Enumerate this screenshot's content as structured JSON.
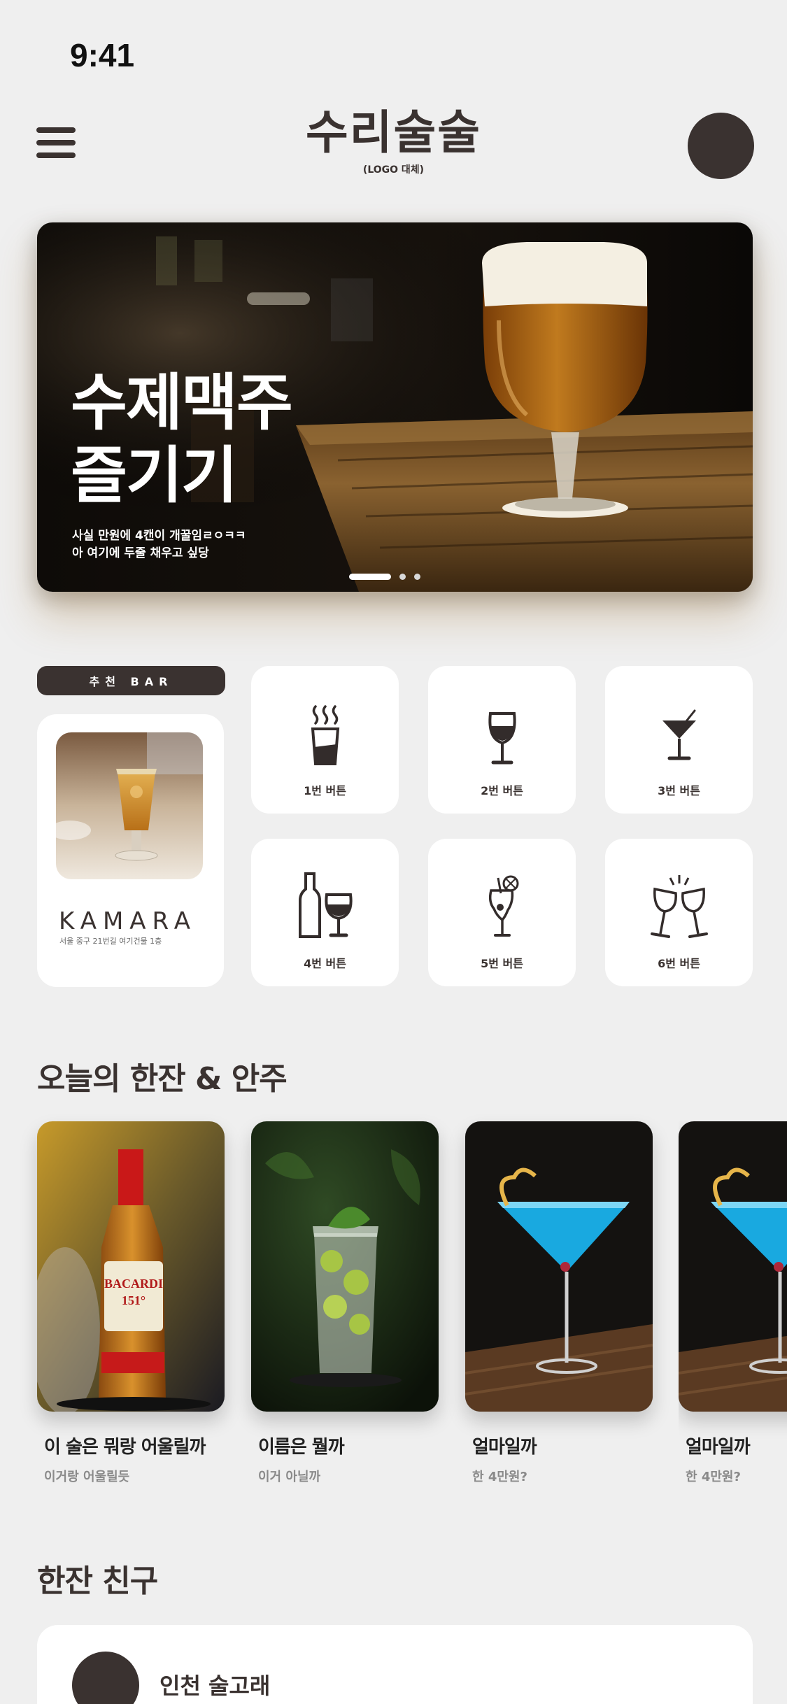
{
  "status_bar": {
    "time": "9:41"
  },
  "header": {
    "title": "수리술술",
    "subtitle": "(LOGO 대체)",
    "menu_icon": "hamburger-icon",
    "profile_icon": "avatar"
  },
  "hero": {
    "title_line1": "수제맥주",
    "title_line2": "즐기기",
    "desc_line1": "사실 만원에 4캔이 개꿀임ㄹㅇㅋㅋ",
    "desc_line2": "아 여기에 두줄 채우고 싶당",
    "slides": 3,
    "active_slide": 1
  },
  "recommended_bar": {
    "tag": "추천 BAR",
    "name": "KAMARA",
    "address": "서울 중구 21번길 여기건물 1층"
  },
  "categories": [
    {
      "label": "1번 버튼",
      "icon": "beer-glass-icon"
    },
    {
      "label": "2번 버튼",
      "icon": "wine-glass-icon"
    },
    {
      "label": "3번 버튼",
      "icon": "cocktail-icon"
    },
    {
      "label": "4번 버튼",
      "icon": "bottle-and-glass-icon"
    },
    {
      "label": "5번 버튼",
      "icon": "tropical-drink-icon"
    },
    {
      "label": "6번 버튼",
      "icon": "cheers-icon"
    }
  ],
  "today_section": {
    "title": "오늘의 한잔 & 안주",
    "items": [
      {
        "name": "이 술은 뭐랑 어울릴까",
        "desc": "이거랑 어울릴듯"
      },
      {
        "name": "이름은 뭘까",
        "desc": "이거 아닐까"
      },
      {
        "name": "얼마일까",
        "desc": "한 4만원?"
      },
      {
        "name": "얼마일까",
        "desc": "한 4만원?"
      }
    ]
  },
  "friends_section": {
    "title": "한잔 친구",
    "friend": {
      "name": "인천 술고래"
    }
  },
  "colors": {
    "background": "#efefef",
    "primary_dark": "#3a3230",
    "card": "#ffffff"
  }
}
